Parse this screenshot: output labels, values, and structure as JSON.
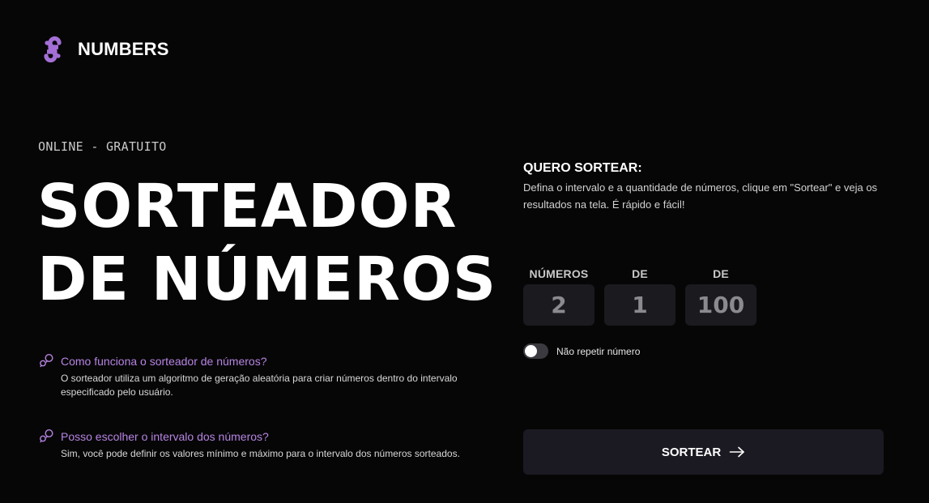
{
  "brand": {
    "name": "NUMBERS",
    "icon": "knot-logo-icon",
    "accent_color": "#a46fd6"
  },
  "hero": {
    "eyebrow": "ONLINE - GRATUITO",
    "title_line1": "SORTEADOR",
    "title_line2": "DE NÚMEROS"
  },
  "faq": [
    {
      "icon": "chat-bubbles-icon",
      "question": "Como funciona o sorteador de números?",
      "answer": "O sorteador utiliza um algoritmo de geração aleatória para criar números dentro do intervalo especificado pelo usuário."
    },
    {
      "icon": "chat-bubbles-icon",
      "question": "Posso escolher o intervalo dos números?",
      "answer": "Sim, você pode definir os valores mínimo e máximo para o intervalo dos números sorteados."
    }
  ],
  "panel": {
    "title": "QUERO SORTEAR:",
    "description": "Defina o intervalo e a quantidade de números, clique em \"Sortear\" e veja os resultados na tela. É rápido e fácil!"
  },
  "fields": {
    "quantity": {
      "label": "NÚMEROS",
      "value": "2"
    },
    "min": {
      "label": "DE",
      "value": "1"
    },
    "max": {
      "label": "DE",
      "value": "100"
    }
  },
  "toggle": {
    "label": "Não repetir número",
    "checked": false
  },
  "draw_button": {
    "label": "SORTEAR",
    "icon": "arrow-right-icon"
  }
}
